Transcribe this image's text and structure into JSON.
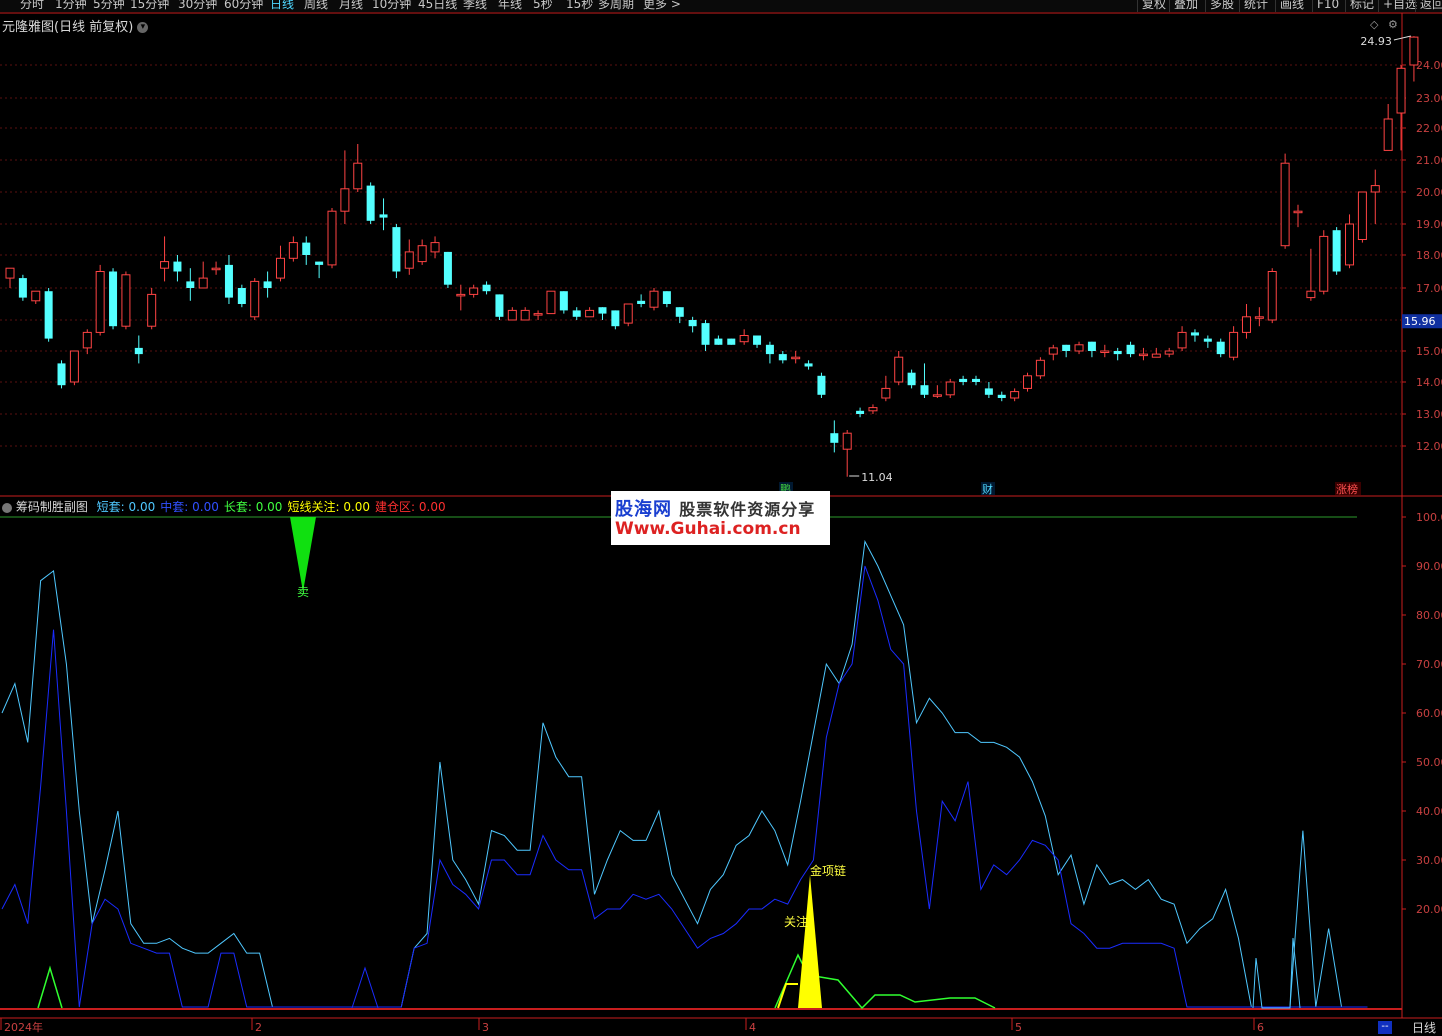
{
  "toolbar": {
    "periods": [
      "分时",
      "1分钟",
      "5分钟",
      "15分钟",
      "30分钟",
      "60分钟",
      "日线",
      "周线",
      "月线",
      "10分钟",
      "45日线",
      "季线",
      "年线",
      "5秒",
      "15秒",
      "多周期",
      "更多 >"
    ],
    "active": "日线",
    "right": [
      "复权",
      "叠加",
      "多股",
      "统计",
      "画线",
      "F10",
      "标记",
      "+自选",
      "返回"
    ]
  },
  "main_chart": {
    "title": "元隆雅图(日线 前复权)",
    "high_label": "24.93",
    "low_label": "11.04",
    "current_price": "15.96",
    "price_axis": [
      "24.00",
      "23.00",
      "22.00",
      "21.00",
      "20.00",
      "19.00",
      "18.00",
      "17.00",
      "16.00",
      "15.00",
      "14.00",
      "13.00",
      "12.00"
    ],
    "markers": [
      {
        "text": "鹏",
        "color": "#40d040"
      },
      {
        "text": "财",
        "color": "#4fd7ff"
      },
      {
        "text": "涨榜",
        "color": "#ff5050"
      }
    ]
  },
  "indicator": {
    "title": "筹码制胜副图",
    "items": [
      {
        "label": "短套:",
        "value": "0.00",
        "color": "#4fc8ff"
      },
      {
        "label": "中套:",
        "value": "0.00",
        "color": "#3050ff"
      },
      {
        "label": "长套:",
        "value": "0.00",
        "color": "#40ff40"
      },
      {
        "label": "短线关注:",
        "value": "0.00",
        "color": "#ffff00"
      },
      {
        "label": "建仓区:",
        "value": "0.00",
        "color": "#ff3030"
      }
    ],
    "axis": [
      "100.00",
      "90.00",
      "80.00",
      "70.00",
      "60.00",
      "50.00",
      "40.00",
      "30.00",
      "20.00"
    ],
    "sell_text": "卖",
    "gold_text": "金项链",
    "focus_text": "关注"
  },
  "bottom": {
    "months": [
      "2024年",
      "2",
      "3",
      "4",
      "5",
      "6"
    ],
    "corner": "--",
    "period_label": "日线"
  },
  "watermark": {
    "brand": "股海网",
    "slogan": "股票软件资源分享",
    "url": "Www.Guhai.com.cn"
  },
  "chart_data": {
    "type": "candlestick",
    "title": "元隆雅图(日线 前复权)",
    "ylim": [
      11.04,
      24.93
    ],
    "candles": [
      [
        17.3,
        17.6,
        17.0,
        17.5
      ],
      [
        17.3,
        16.7,
        16.6,
        17.4
      ],
      [
        16.6,
        16.9,
        16.5,
        16.9
      ],
      [
        16.9,
        15.4,
        15.3,
        17.0
      ],
      [
        14.6,
        13.9,
        13.8,
        14.7
      ],
      [
        14.0,
        15.0,
        13.9,
        15.0
      ],
      [
        15.1,
        15.6,
        14.9,
        15.7
      ],
      [
        15.6,
        17.5,
        15.5,
        17.7
      ],
      [
        17.5,
        15.8,
        15.7,
        17.6
      ],
      [
        15.8,
        17.4,
        15.7,
        17.5
      ],
      [
        15.1,
        14.9,
        14.6,
        15.5
      ],
      [
        15.8,
        16.8,
        15.7,
        17.0
      ],
      [
        17.6,
        17.8,
        17.2,
        18.6
      ],
      [
        17.8,
        17.5,
        17.2,
        18.0
      ],
      [
        17.2,
        17.0,
        16.6,
        17.6
      ],
      [
        17.0,
        17.3,
        17.0,
        17.8
      ],
      [
        17.6,
        17.6,
        17.4,
        17.8
      ],
      [
        17.7,
        16.7,
        16.5,
        18.0
      ],
      [
        17.0,
        16.5,
        16.4,
        17.1
      ],
      [
        16.1,
        17.2,
        16.0,
        17.3
      ],
      [
        17.2,
        17.0,
        16.7,
        17.5
      ],
      [
        17.3,
        17.9,
        17.2,
        18.3
      ],
      [
        17.9,
        18.4,
        17.8,
        18.6
      ],
      [
        18.4,
        18.0,
        17.7,
        18.6
      ],
      [
        17.8,
        17.7,
        17.3,
        17.8
      ],
      [
        17.7,
        19.4,
        17.6,
        19.5
      ],
      [
        19.4,
        20.1,
        19.0,
        21.3
      ],
      [
        20.1,
        20.9,
        20.0,
        21.5
      ],
      [
        20.2,
        19.1,
        19.0,
        20.3
      ],
      [
        19.3,
        19.2,
        18.8,
        19.8
      ],
      [
        18.9,
        17.5,
        17.3,
        19.0
      ],
      [
        17.6,
        18.1,
        17.4,
        18.5
      ],
      [
        17.8,
        18.3,
        17.7,
        18.5
      ],
      [
        18.1,
        18.4,
        17.9,
        18.6
      ],
      [
        18.1,
        17.1,
        17.0,
        18.1
      ],
      [
        16.8,
        16.8,
        16.3,
        17.1
      ],
      [
        16.8,
        17.0,
        16.7,
        17.1
      ],
      [
        17.1,
        16.9,
        16.8,
        17.2
      ],
      [
        16.8,
        16.1,
        16.0,
        16.8
      ],
      [
        16.0,
        16.3,
        16.0,
        16.4
      ],
      [
        16.0,
        16.3,
        16.0,
        16.4
      ],
      [
        16.2,
        16.2,
        16.0,
        16.3
      ],
      [
        16.2,
        16.9,
        16.2,
        16.9
      ],
      [
        16.9,
        16.3,
        16.2,
        16.9
      ],
      [
        16.3,
        16.1,
        16.0,
        16.4
      ],
      [
        16.1,
        16.3,
        16.1,
        16.4
      ],
      [
        16.4,
        16.2,
        16.0,
        16.4
      ],
      [
        16.3,
        15.8,
        15.7,
        16.3
      ],
      [
        15.9,
        16.5,
        15.8,
        16.5
      ],
      [
        16.6,
        16.5,
        16.4,
        16.8
      ],
      [
        16.4,
        16.9,
        16.3,
        17.0
      ],
      [
        16.9,
        16.5,
        16.4,
        16.9
      ],
      [
        16.4,
        16.1,
        15.9,
        16.4
      ],
      [
        16.0,
        15.8,
        15.6,
        16.1
      ],
      [
        15.9,
        15.2,
        15.0,
        16.0
      ],
      [
        15.4,
        15.2,
        15.2,
        15.5
      ],
      [
        15.4,
        15.2,
        15.2,
        15.4
      ],
      [
        15.3,
        15.5,
        15.2,
        15.7
      ],
      [
        15.5,
        15.2,
        15.1,
        15.5
      ],
      [
        15.2,
        14.9,
        14.6,
        15.3
      ],
      [
        14.9,
        14.7,
        14.6,
        15.0
      ],
      [
        14.8,
        14.8,
        14.6,
        15.0
      ],
      [
        14.6,
        14.5,
        14.4,
        14.7
      ],
      [
        14.2,
        13.6,
        13.5,
        14.3
      ],
      [
        12.4,
        12.1,
        11.8,
        12.8
      ],
      [
        11.9,
        12.4,
        11.04,
        12.5
      ],
      [
        13.1,
        13.0,
        12.9,
        13.2
      ],
      [
        13.1,
        13.2,
        13.0,
        13.3
      ],
      [
        13.5,
        13.8,
        13.4,
        14.2
      ],
      [
        14.0,
        14.8,
        13.9,
        15.0
      ],
      [
        14.3,
        13.9,
        13.8,
        14.4
      ],
      [
        13.9,
        13.6,
        13.5,
        14.6
      ],
      [
        13.6,
        13.6,
        13.5,
        13.9
      ],
      [
        13.6,
        14.0,
        13.5,
        14.1
      ],
      [
        14.1,
        14.0,
        13.9,
        14.2
      ],
      [
        14.1,
        14.0,
        13.9,
        14.2
      ],
      [
        13.8,
        13.6,
        13.5,
        14.0
      ],
      [
        13.6,
        13.5,
        13.4,
        13.7
      ],
      [
        13.5,
        13.7,
        13.4,
        13.8
      ],
      [
        13.8,
        14.2,
        13.7,
        14.3
      ],
      [
        14.2,
        14.7,
        14.1,
        14.8
      ],
      [
        14.9,
        15.1,
        14.7,
        15.2
      ],
      [
        15.2,
        15.0,
        14.8,
        15.2
      ],
      [
        15.0,
        15.2,
        14.9,
        15.3
      ],
      [
        15.3,
        15.0,
        14.8,
        15.3
      ],
      [
        15.0,
        15.0,
        14.8,
        15.2
      ],
      [
        15.0,
        14.9,
        14.7,
        15.1
      ],
      [
        15.2,
        14.9,
        14.8,
        15.3
      ],
      [
        14.9,
        14.9,
        14.7,
        15.1
      ],
      [
        14.8,
        14.9,
        14.8,
        15.1
      ],
      [
        14.9,
        15.0,
        14.8,
        15.1
      ],
      [
        15.1,
        15.6,
        15.0,
        15.8
      ],
      [
        15.6,
        15.5,
        15.3,
        15.7
      ],
      [
        15.4,
        15.3,
        15.1,
        15.5
      ],
      [
        15.3,
        14.9,
        14.8,
        15.4
      ],
      [
        14.8,
        15.6,
        14.7,
        15.8
      ],
      [
        15.6,
        16.1,
        15.4,
        16.5
      ],
      [
        16.1,
        16.1,
        15.8,
        16.4
      ],
      [
        16.0,
        17.5,
        15.9,
        17.6
      ],
      [
        18.3,
        20.9,
        18.2,
        21.2
      ],
      [
        19.4,
        19.4,
        18.9,
        19.6
      ],
      [
        16.7,
        16.9,
        16.6,
        18.2
      ],
      [
        16.9,
        18.6,
        16.8,
        18.8
      ],
      [
        18.8,
        17.5,
        17.4,
        18.9
      ],
      [
        17.7,
        19.0,
        17.6,
        19.3
      ],
      [
        18.5,
        20.0,
        18.4,
        20.0
      ],
      [
        20.0,
        20.2,
        19.0,
        20.7
      ],
      [
        21.3,
        22.3,
        21.3,
        22.8
      ],
      [
        22.5,
        23.9,
        21.3,
        24.0
      ],
      [
        24.0,
        24.9,
        23.5,
        24.93
      ]
    ],
    "indicator_series": {
      "短套": [
        60,
        66,
        54,
        87,
        89,
        70,
        40,
        17,
        28,
        40,
        17,
        13,
        13,
        14,
        12,
        11,
        11,
        13,
        15,
        11,
        11,
        10,
        10,
        10,
        10,
        10,
        10,
        10,
        10,
        10,
        10,
        10,
        12,
        15,
        50,
        30,
        26,
        21,
        36,
        35,
        32,
        32,
        58,
        51,
        47,
        47,
        23,
        30,
        36,
        34,
        34,
        40,
        27,
        22,
        17,
        24,
        27,
        33,
        35,
        40,
        36,
        29,
        42,
        56,
        70,
        66,
        74,
        95,
        90,
        84,
        78,
        58,
        63,
        60,
        56,
        56,
        54,
        54,
        53,
        51,
        46,
        39,
        27,
        31,
        21,
        29,
        25,
        26,
        24,
        26,
        22,
        21,
        13,
        16,
        18,
        24,
        14,
        10,
        10,
        10,
        10,
        36,
        10,
        16,
        10,
        10,
        10
      ],
      "中套": [
        20,
        25,
        17,
        45,
        77,
        40,
        10,
        17,
        22,
        20,
        13,
        12,
        11,
        11,
        10,
        10,
        10,
        11,
        11,
        10,
        10,
        10,
        10,
        10,
        10,
        10,
        10,
        10,
        10,
        10,
        10,
        10,
        12,
        13,
        30,
        25,
        23,
        20,
        30,
        30,
        27,
        27,
        35,
        30,
        28,
        28,
        18,
        20,
        20,
        23,
        22,
        23,
        20,
        16,
        12,
        14,
        15,
        17,
        20,
        20,
        22,
        21,
        26,
        30,
        55,
        66,
        70,
        90,
        83,
        73,
        70,
        40,
        20,
        42,
        38,
        46,
        24,
        29,
        27,
        30,
        34,
        33,
        30,
        17,
        15,
        12,
        12,
        13,
        13,
        13,
        13,
        12,
        10,
        10,
        10,
        10,
        10,
        10,
        10,
        10,
        10,
        10,
        10,
        10,
        10,
        10,
        10
      ]
    }
  }
}
